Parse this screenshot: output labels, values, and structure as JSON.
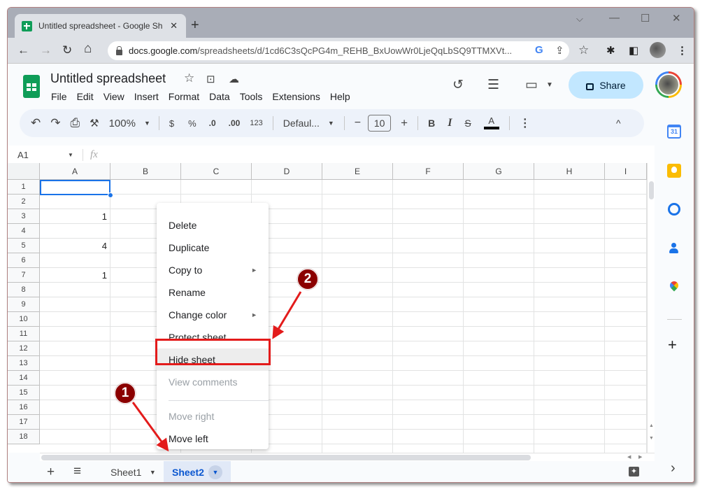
{
  "browser": {
    "tab_title": "Untitled spreadsheet - Google Sh",
    "tab_close": "✕",
    "new_tab": "+",
    "window_controls": {
      "dropdown": "⌵",
      "minimize": "—",
      "maximize": "☐",
      "close": "✕"
    },
    "nav": {
      "back": "←",
      "forward": "→",
      "reload": "↻",
      "home": "⌂"
    },
    "url_domain": "docs.google.com",
    "url_path": "/spreadsheets/d/1cd6C3sQcPG4m_REHB_BxUowWr0LjeQqLbSQ9TTMXVt...",
    "omni_icons": {
      "google": "G",
      "share": "⇪",
      "bookmark": "☆"
    },
    "ext_icons": {
      "extensions": "✱",
      "sidepanel": "◧",
      "menu": "⋮"
    }
  },
  "app": {
    "title": "Untitled spreadsheet",
    "title_icons": {
      "star": "☆",
      "move": "⊡",
      "cloud": "☁"
    },
    "menus": [
      "File",
      "Edit",
      "View",
      "Insert",
      "Format",
      "Data",
      "Tools",
      "Extensions",
      "Help"
    ],
    "share_label": "Share",
    "topright_icons": {
      "history": "↺",
      "comments": "☰",
      "meet": "▭"
    }
  },
  "toolbar": {
    "undo": "↶",
    "redo": "↷",
    "print": "⎙",
    "paint_format": "⚒",
    "zoom": "100%",
    "currency": "$",
    "percent": "%",
    "dec_decrease": ".0",
    "dec_increase": ".00",
    "more_formats": "123",
    "font": "Defaul...",
    "font_minus": "−",
    "font_size": "10",
    "font_plus": "+",
    "bold": "B",
    "italic": "I",
    "strike": "S",
    "text_color": "A",
    "more": "⋮",
    "collapse": "^"
  },
  "formula_bar": {
    "cell_ref": "A1",
    "fx": "fx",
    "value": ""
  },
  "grid": {
    "columns": [
      "A",
      "B",
      "C",
      "D",
      "E",
      "F",
      "G",
      "H",
      "I"
    ],
    "rows": [
      "1",
      "2",
      "3",
      "4",
      "5",
      "6",
      "7",
      "8",
      "9",
      "10",
      "11",
      "12",
      "13",
      "14",
      "15",
      "16",
      "17",
      "18"
    ],
    "cells": [
      {
        "ref": "A3",
        "value": "1"
      },
      {
        "ref": "A5",
        "value": "4"
      },
      {
        "ref": "A7",
        "value": "1"
      }
    ],
    "selected": "A1"
  },
  "sheets": {
    "add": "+",
    "all_sheets": "≡",
    "tabs": [
      {
        "name": "Sheet1",
        "active": false
      },
      {
        "name": "Sheet2",
        "active": true
      }
    ],
    "explore": "✦",
    "side_toggle": "›"
  },
  "context_menu": {
    "items": [
      {
        "label": "Delete",
        "disabled": false,
        "submenu": false
      },
      {
        "label": "Duplicate",
        "disabled": false,
        "submenu": false
      },
      {
        "label": "Copy to",
        "disabled": false,
        "submenu": true
      },
      {
        "label": "Rename",
        "disabled": false,
        "submenu": false
      },
      {
        "label": "Change color",
        "disabled": false,
        "submenu": true
      },
      {
        "label": "Protect sheet",
        "disabled": false,
        "submenu": false
      },
      {
        "label": "Hide sheet",
        "disabled": false,
        "submenu": false,
        "highlighted": true
      },
      {
        "label": "View comments",
        "disabled": true,
        "submenu": false
      },
      {
        "label": "Move right",
        "disabled": true,
        "submenu": false
      },
      {
        "label": "Move left",
        "disabled": false,
        "submenu": false
      }
    ],
    "submenu_arrow": "►"
  },
  "annotations": {
    "step1": "1",
    "step2": "2",
    "color": "#e31b1b",
    "badge_color": "#8b0000"
  },
  "side_panel": {
    "calendar_label": "31",
    "add": "+"
  }
}
